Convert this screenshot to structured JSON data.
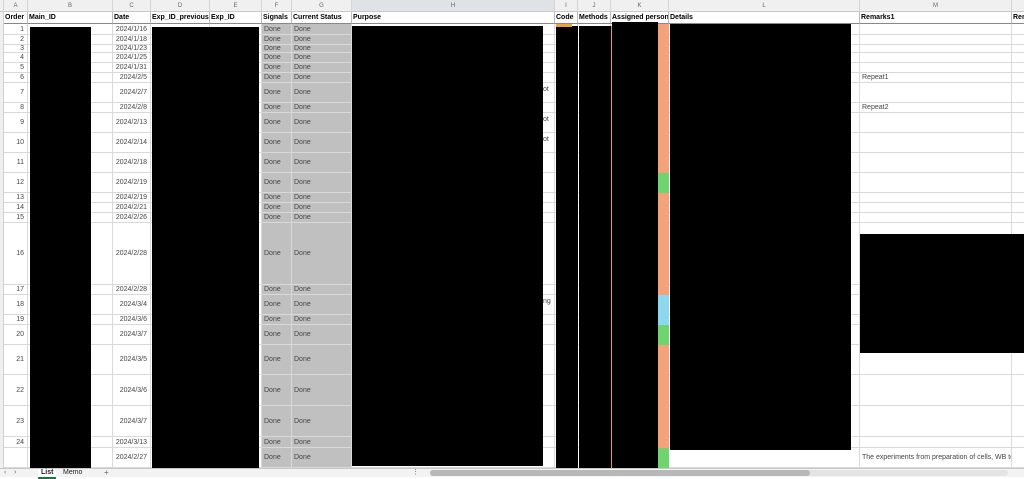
{
  "columns": [
    {
      "letter": "A"
    },
    {
      "letter": "B"
    },
    {
      "letter": "C"
    },
    {
      "letter": "D"
    },
    {
      "letter": "E"
    },
    {
      "letter": "F"
    },
    {
      "letter": "G"
    },
    {
      "letter": "H"
    },
    {
      "letter": "I"
    },
    {
      "letter": "J"
    },
    {
      "letter": "K"
    },
    {
      "letter": "L"
    },
    {
      "letter": "M"
    },
    {
      "letter": "N"
    }
  ],
  "headers": {
    "order": "Order",
    "main_id": "Main_ID",
    "date": "Date",
    "exp_prev": "Exp_ID_previous",
    "exp_id": "Exp_ID",
    "signals": "Signals",
    "status": "Current Status",
    "purpose": "Purpose",
    "code": "Code",
    "methods": "Methods",
    "assigned": "Assigned person",
    "details": "Details",
    "remarks1": "Remarks1",
    "remarks2": "Rem"
  },
  "rows": [
    {
      "order": "1",
      "date": "2024/1/16",
      "signals": "Done",
      "status": "Done",
      "remarks1": "",
      "marker": "orange"
    },
    {
      "order": "2",
      "date": "2024/1/18",
      "signals": "Done",
      "status": "Done",
      "remarks1": "",
      "marker": "orange"
    },
    {
      "order": "3",
      "date": "2024/1/23",
      "signals": "Done",
      "status": "Done",
      "remarks1": "",
      "marker": "orange"
    },
    {
      "order": "4",
      "date": "2024/1/25",
      "signals": "Done",
      "status": "Done",
      "remarks1": "",
      "marker": "orange"
    },
    {
      "order": "5",
      "date": "2024/1/31",
      "signals": "Done",
      "status": "Done",
      "remarks1": "",
      "marker": "orange"
    },
    {
      "order": "6",
      "date": "2024/2/5",
      "signals": "Done",
      "status": "Done",
      "remarks1": "Repeat1",
      "marker": "orange"
    },
    {
      "order": "7",
      "date": "2024/2/7",
      "signals": "Done",
      "status": "Done",
      "remarks1": "",
      "marker": "orange"
    },
    {
      "order": "8",
      "date": "2024/2/8",
      "signals": "Done",
      "status": "Done",
      "remarks1": "Repeat2",
      "marker": "orange"
    },
    {
      "order": "9",
      "date": "2024/2/13",
      "signals": "Done",
      "status": "Done",
      "remarks1": "",
      "marker": "orange"
    },
    {
      "order": "10",
      "date": "2024/2/14",
      "signals": "Done",
      "status": "Done",
      "remarks1": "",
      "marker": "orange"
    },
    {
      "order": "11",
      "date": "2024/2/18",
      "signals": "Done",
      "status": "Done",
      "remarks1": "",
      "marker": "orange"
    },
    {
      "order": "12",
      "date": "2024/2/19",
      "signals": "Done",
      "status": "Done",
      "remarks1": "",
      "marker": "green"
    },
    {
      "order": "13",
      "date": "2024/2/19",
      "signals": "Done",
      "status": "Done",
      "remarks1": "",
      "marker": "orange"
    },
    {
      "order": "14",
      "date": "2024/2/21",
      "signals": "Done",
      "status": "Done",
      "remarks1": "",
      "marker": "orange"
    },
    {
      "order": "15",
      "date": "2024/2/26",
      "signals": "Done",
      "status": "Done",
      "remarks1": "",
      "marker": "orange"
    },
    {
      "order": "16",
      "date": "2024/2/28",
      "signals": "Done",
      "status": "Done",
      "remarks1": "",
      "marker": "orange"
    },
    {
      "order": "17",
      "date": "2024/2/28",
      "signals": "Done",
      "status": "Done",
      "remarks1": "",
      "marker": "orange"
    },
    {
      "order": "18",
      "date": "2024/3/4",
      "signals": "Done",
      "status": "Done",
      "remarks1": "",
      "marker": "blue"
    },
    {
      "order": "19",
      "date": "2024/3/6",
      "signals": "Done",
      "status": "Done",
      "remarks1": "",
      "marker": "blue"
    },
    {
      "order": "20",
      "date": "2024/3/7",
      "signals": "Done",
      "status": "Done",
      "remarks1": "",
      "marker": "green"
    },
    {
      "order": "21",
      "date": "2024/3/5",
      "signals": "Done",
      "status": "Done",
      "remarks1": "",
      "marker": "orange"
    },
    {
      "order": "22",
      "date": "2024/3/6",
      "signals": "Done",
      "status": "Done",
      "remarks1": "",
      "marker": "orange"
    },
    {
      "order": "23",
      "date": "2024/3/7",
      "signals": "Done",
      "status": "Done",
      "remarks1": "",
      "marker": "orange"
    },
    {
      "order": "24",
      "date": "2024/3/13",
      "signals": "Done",
      "status": "Done",
      "remarks1": "",
      "marker": "orange"
    },
    {
      "order": "",
      "date": "2024/2/27",
      "signals": "Done",
      "status": "Done",
      "remarks1": "The experiments from preparation of cells, WB to",
      "marker": "green"
    }
  ],
  "purpose_fragments": [
    {
      "row": 6,
      "text": "ot"
    },
    {
      "row": 8,
      "text": "ot"
    },
    {
      "row": 9,
      "text": "ot"
    },
    {
      "row": 17,
      "text": "ng"
    }
  ],
  "sheet_tabs": [
    {
      "label": "List",
      "active": true
    },
    {
      "label": "Memo",
      "active": false
    }
  ],
  "tab_bar": {
    "add": "+",
    "prev": "‹",
    "next": "›",
    "more": "⋮"
  },
  "colors": {
    "orange": "#f4a27a",
    "green": "#6fd46f",
    "blue": "#8dd7ef",
    "gray": "#c0c0c0",
    "accent": "#217346"
  }
}
